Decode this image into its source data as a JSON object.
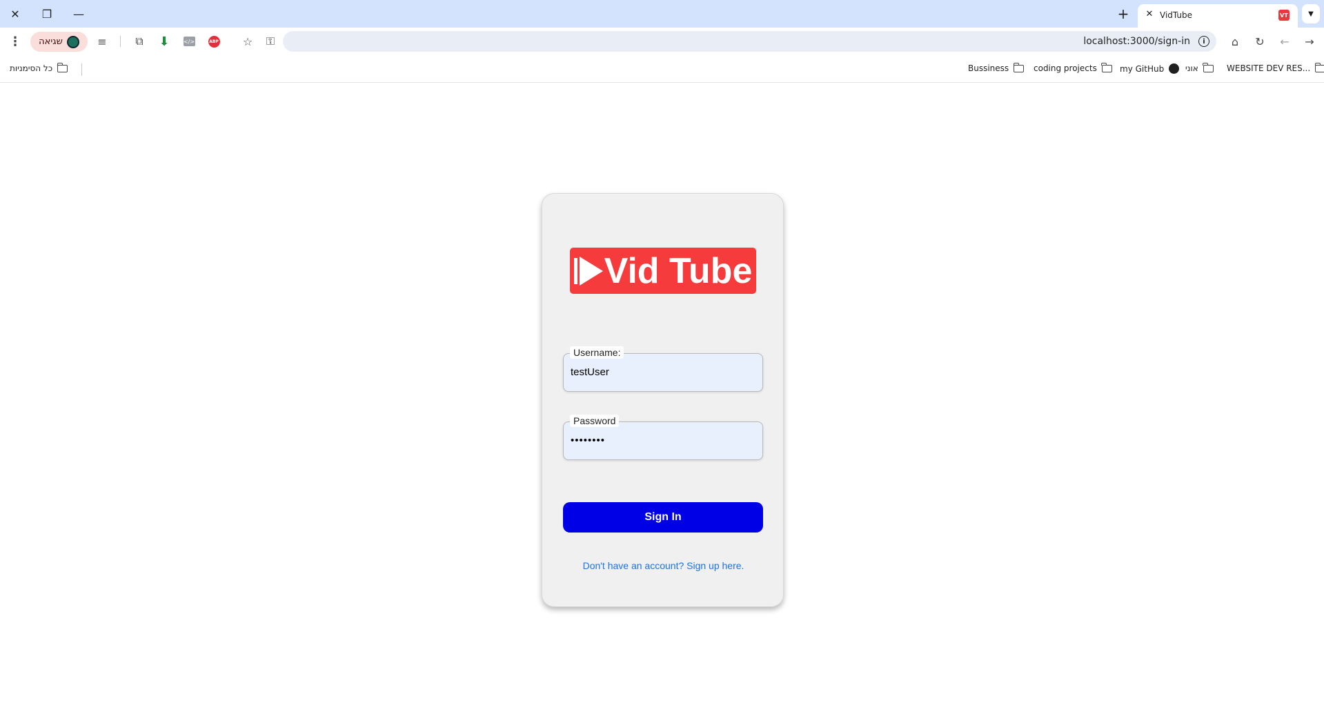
{
  "browser": {
    "tab": {
      "title": "VidTube",
      "favicon": "VT"
    },
    "error_pill": {
      "label": "שגיאה"
    },
    "url": "localhost:3000/sign-in",
    "bookmarks": [
      {
        "label": "WEBSITE DEV RES...",
        "icon": "folder-icon"
      },
      {
        "label": "אוני",
        "icon": "folder-icon"
      },
      {
        "label": "my GitHub",
        "icon": "github-icon"
      },
      {
        "label": "coding projects",
        "icon": "folder-icon"
      },
      {
        "label": "Bussiness",
        "icon": "folder-icon"
      }
    ],
    "all_bookmarks": "כל הסימניות"
  },
  "signin": {
    "logo_text": "Vid Tube",
    "username": {
      "label": "Username:",
      "value": "testUser"
    },
    "password": {
      "label": "Password",
      "value": "••••••••"
    },
    "submit_label": "Sign In",
    "signup_text": "Don't have an account? Sign up here."
  },
  "colors": {
    "logo_bg": "#f53b3b",
    "button_bg": "#0000e6",
    "link": "#1a73e8",
    "card_bg": "#f0f0f0",
    "input_bg": "#e8f0fe"
  }
}
